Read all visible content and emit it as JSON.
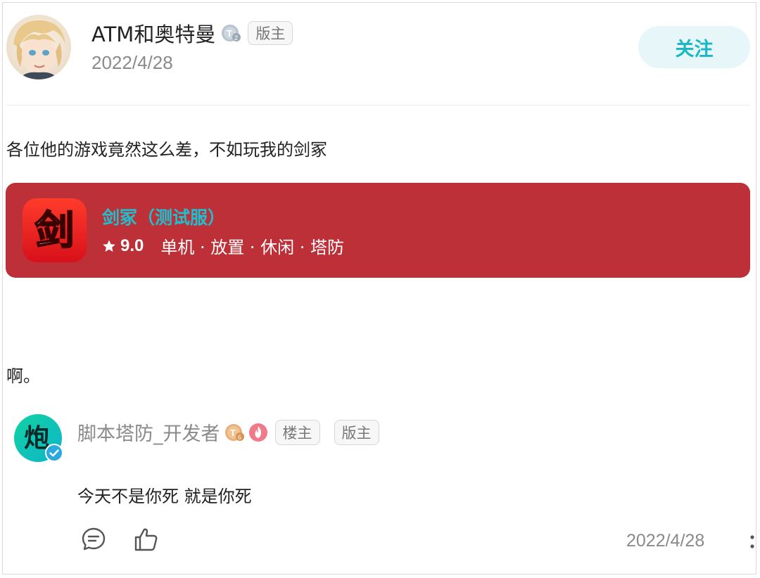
{
  "post": {
    "author": "ATM和奥特曼",
    "author_level_badge": "T2",
    "author_role": "版主",
    "date": "2022/4/28",
    "follow_label": "关注",
    "body_line1": "各位他的游戏竟然这么差，不如玩我的剑冢",
    "body_line2": "啊。"
  },
  "game_card": {
    "icon_glyph": "剑",
    "name": "剑冢（测试服）",
    "rating": "9.0",
    "tags": "单机 · 放置 · 休闲 · 塔防",
    "background": "#bd3037",
    "name_color": "#1ec0cf"
  },
  "reply": {
    "author": "脚本塔防_开发者",
    "avatar_glyph": "炮",
    "level_badge": "T6",
    "tag_op": "楼主",
    "tag_role": "版主",
    "text": "今天不是你死 就是你死",
    "date": "2022/4/28"
  },
  "icons": {
    "comment": "comment-icon",
    "like": "thumbs-up-icon",
    "more": "more-vertical-icon",
    "star": "star-icon",
    "verified": "verified-check-icon",
    "fire": "fire-badge-icon"
  },
  "colors": {
    "accent": "#1bb7c4",
    "follow_bg": "#e7f7f9",
    "card_red": "#bd3037"
  }
}
